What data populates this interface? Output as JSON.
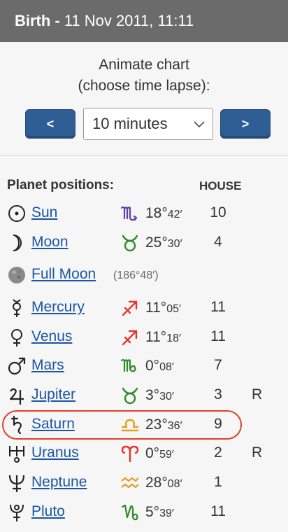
{
  "header": {
    "title_bold": "Birth -",
    "date": "11 Nov 2011, 11:11"
  },
  "animate": {
    "line1": "Animate chart",
    "line2": "(choose time lapse):",
    "prev_label": "<",
    "next_label": ">",
    "selected": "10 minutes"
  },
  "section": {
    "title": "Planet positions:",
    "house_header": "HOUSE"
  },
  "full_moon": {
    "label": "Full Moon",
    "degree": "(186°48′)"
  },
  "planets": [
    {
      "name": "Sun",
      "sign_icon": "scorpio-icon",
      "deg": "18°",
      "min": "42′",
      "house": "10",
      "retro": ""
    },
    {
      "name": "Moon",
      "sign_icon": "taurus-icon",
      "deg": "25°",
      "min": "30′",
      "house": "4",
      "retro": ""
    },
    {
      "name": "Mercury",
      "sign_icon": "sagittarius-icon",
      "deg": "11°",
      "min": "05′",
      "house": "11",
      "retro": ""
    },
    {
      "name": "Venus",
      "sign_icon": "sagittarius-icon",
      "deg": "11°",
      "min": "18′",
      "house": "11",
      "retro": ""
    },
    {
      "name": "Mars",
      "sign_icon": "virgo-icon",
      "deg": "0°",
      "min": "08′",
      "house": "7",
      "retro": ""
    },
    {
      "name": "Jupiter",
      "sign_icon": "taurus-icon",
      "deg": "3°",
      "min": "30′",
      "house": "3",
      "retro": "R"
    },
    {
      "name": "Saturn",
      "sign_icon": "libra-icon",
      "deg": "23°",
      "min": "36′",
      "house": "9",
      "retro": ""
    },
    {
      "name": "Uranus",
      "sign_icon": "aries-icon",
      "deg": "0°",
      "min": "59′",
      "house": "2",
      "retro": "R"
    },
    {
      "name": "Neptune",
      "sign_icon": "aquarius-icon",
      "deg": "28°",
      "min": "08′",
      "house": "1",
      "retro": ""
    },
    {
      "name": "Pluto",
      "sign_icon": "capricorn-icon",
      "deg": "5°",
      "min": "39′",
      "house": "11",
      "retro": ""
    }
  ],
  "colors": {
    "header_bg": "#6b6b6b",
    "button_bg": "#2f5e94",
    "link": "#1a56a8",
    "fire": "#e5352b",
    "earth": "#2f8a2a",
    "air": "#e0a020",
    "water": "#5a3fb0",
    "highlight": "#e0402a"
  }
}
